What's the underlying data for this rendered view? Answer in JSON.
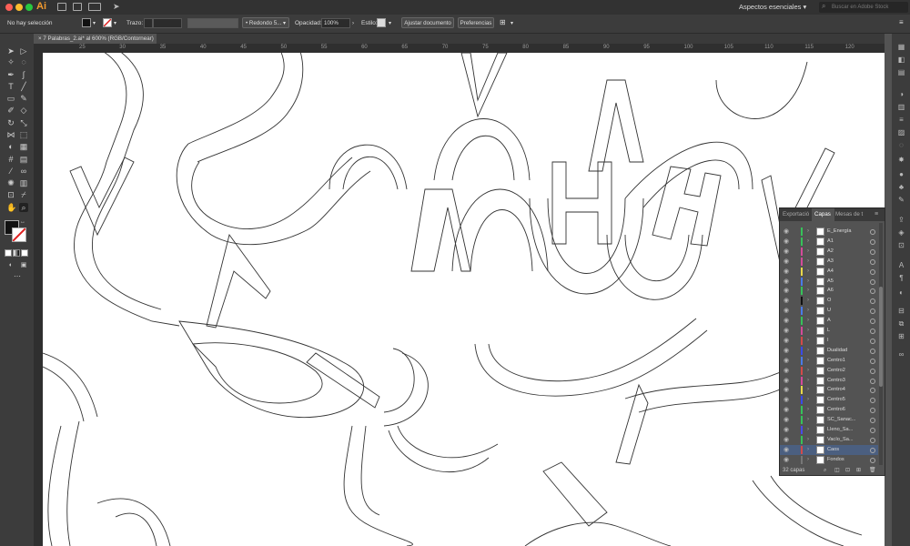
{
  "app": {
    "logo": "Ai",
    "workspace": "Aspectos esenciales",
    "search_placeholder": "Buscar en Adobe Stock"
  },
  "control": {
    "selection_status": "No hay selección",
    "stroke_label": "Trazo:",
    "brush_value": "Redondo 5...",
    "opacity_label": "Opacidad:",
    "opacity_value": "100%",
    "style_label": "Estilo:",
    "adjust_button": "Ajustar documento",
    "prefs_button": "Preferencias"
  },
  "document": {
    "tab_title": "7 Palabras_2.ai* al 600% (RGB/Contornear)"
  },
  "ruler": {
    "h_ticks": [
      "25",
      "30",
      "35",
      "40",
      "45",
      "50",
      "55",
      "60",
      "65",
      "70",
      "75",
      "80",
      "85",
      "90",
      "95",
      "100",
      "105",
      "110",
      "115",
      "120"
    ]
  },
  "layers_panel": {
    "tabs": [
      "Exportació",
      "Capas",
      "Mesas de t"
    ],
    "active_tab": "Capas",
    "layers": [
      {
        "name": "E_Energía",
        "color": "#36c25a"
      },
      {
        "name": "A1",
        "color": "#36c25a"
      },
      {
        "name": "A2",
        "color": "#d44a9a"
      },
      {
        "name": "A3",
        "color": "#d44a9a"
      },
      {
        "name": "A4",
        "color": "#e8d84a"
      },
      {
        "name": "A5",
        "color": "#4a7ae8"
      },
      {
        "name": "A6",
        "color": "#36c25a"
      },
      {
        "name": "O",
        "color": "#111111"
      },
      {
        "name": "U",
        "color": "#4a7ae8"
      },
      {
        "name": "A",
        "color": "#36c25a"
      },
      {
        "name": "L",
        "color": "#d44a9a"
      },
      {
        "name": "I",
        "color": "#d44a4a"
      },
      {
        "name": "Dualidad",
        "color": "#3a4ae8"
      },
      {
        "name": "Centro1",
        "color": "#4a7ae8"
      },
      {
        "name": "Centro2",
        "color": "#d44a4a"
      },
      {
        "name": "Centro3",
        "color": "#d44a9a"
      },
      {
        "name": "Centro4",
        "color": "#e8d84a"
      },
      {
        "name": "Centro5",
        "color": "#3a4ae8"
      },
      {
        "name": "Centro6",
        "color": "#36c25a"
      },
      {
        "name": "SC_Sanac...",
        "color": "#36c25a"
      },
      {
        "name": "Lleno_Sa...",
        "color": "#4a4ae8"
      },
      {
        "name": "Vacío_Sa...",
        "color": "#36c25a"
      },
      {
        "name": "Caos",
        "color": "#d44a4a"
      },
      {
        "name": "Fondos",
        "color": "#777777"
      }
    ],
    "selected_layer": "Caos",
    "footer": "32 capas"
  }
}
